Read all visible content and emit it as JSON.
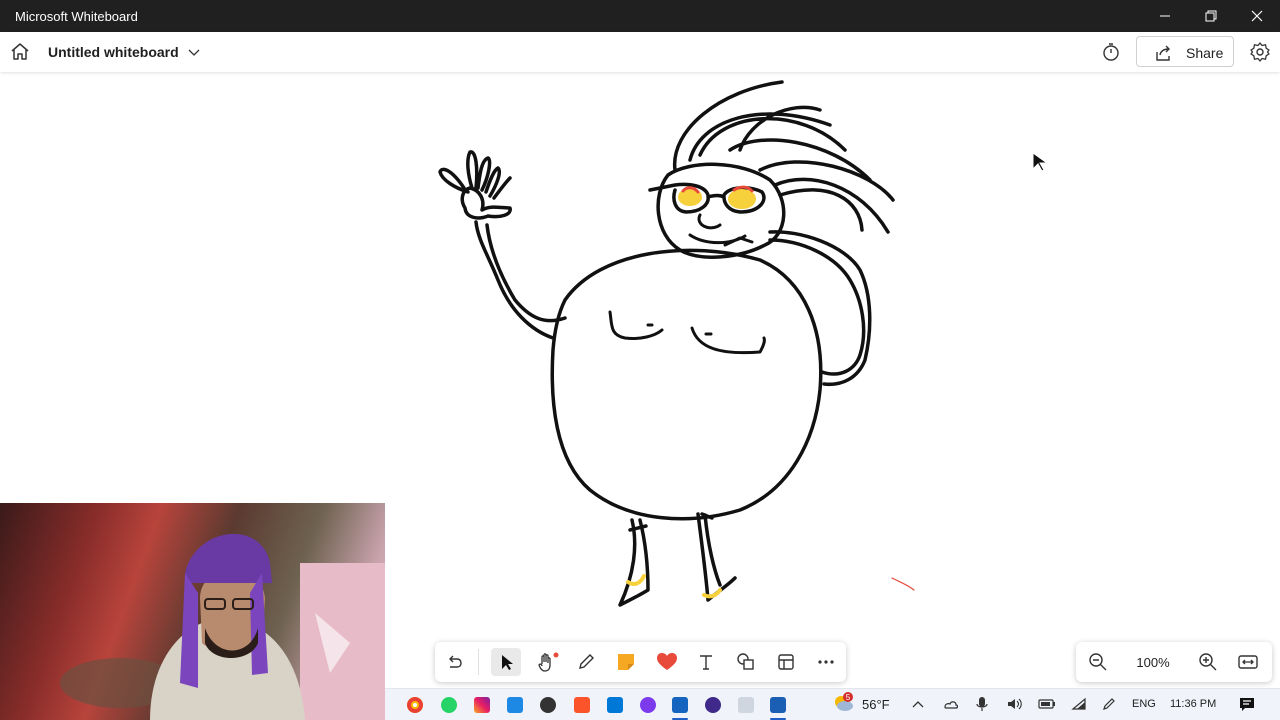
{
  "window": {
    "title": "Microsoft Whiteboard"
  },
  "header": {
    "board_title": "Untitled whiteboard",
    "share_label": "Share"
  },
  "toolbar": {
    "tools": [
      "undo-icon",
      "select-icon",
      "hand-icon",
      "pen-icon",
      "sticky-note-icon",
      "reactions-icon",
      "text-icon",
      "shapes-icon",
      "templates-icon",
      "more-icon"
    ],
    "active_tool": "select-icon"
  },
  "zoom": {
    "level": "100%"
  },
  "taskbar": {
    "weather": {
      "temperature": "56°F",
      "badge": "5"
    },
    "language": "ENG",
    "time": "11:36 PM"
  },
  "colors": {
    "titlebar": "#202020",
    "ink": "#111111",
    "highlight_yellow": "#f7d13b",
    "accent_red": "#e84a3c"
  }
}
